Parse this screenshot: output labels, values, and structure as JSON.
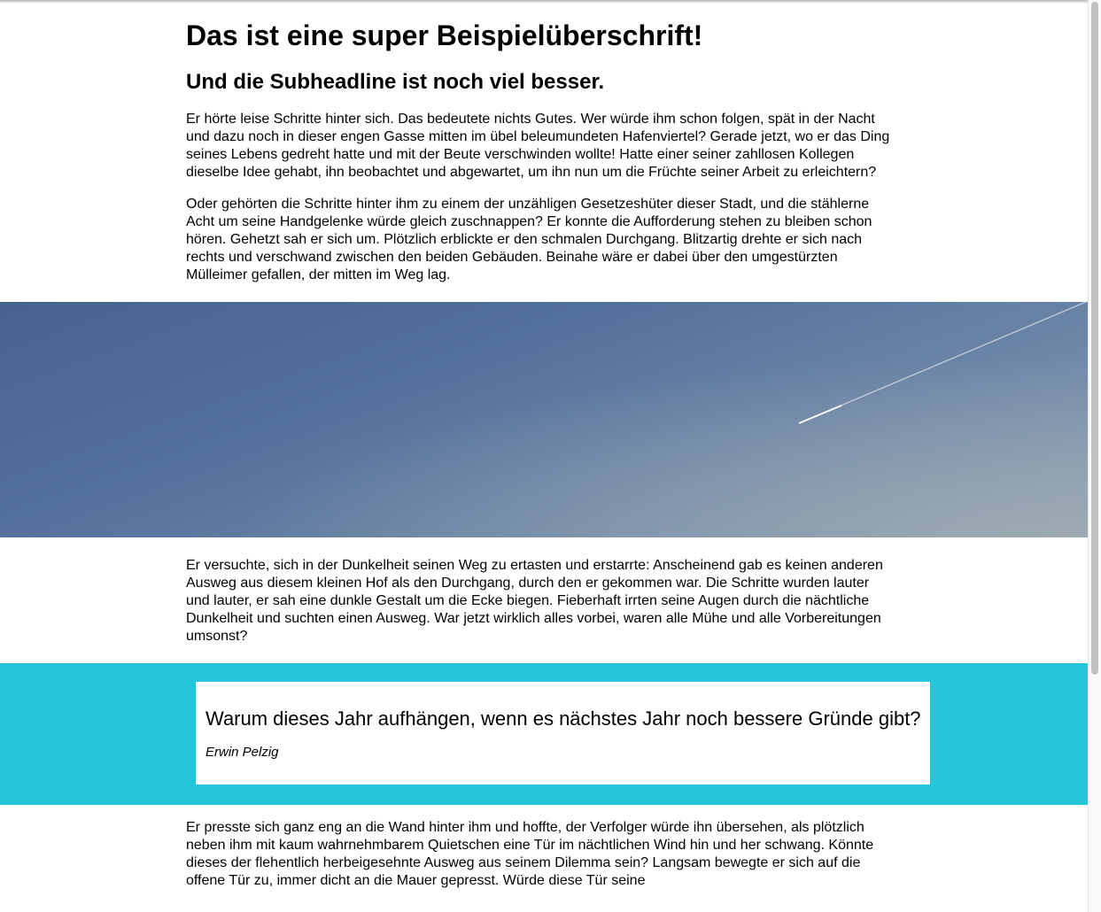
{
  "article": {
    "headline": "Das ist eine super Beispielüberschrift!",
    "subheadline": "Und die Subheadline ist noch viel besser.",
    "paragraph_1": "Er hörte leise Schritte hinter sich. Das bedeutete nichts Gutes. Wer würde ihm schon folgen, spät in der Nacht und dazu noch in dieser engen Gasse mitten im übel beleumundeten Hafenviertel? Gerade jetzt, wo er das Ding seines Lebens gedreht hatte und mit der Beute verschwinden wollte! Hatte einer seiner zahllosen Kollegen dieselbe Idee gehabt, ihn beobachtet und abgewartet, um ihn nun um die Früchte seiner Arbeit zu erleichtern?",
    "paragraph_2": "Oder gehörten die Schritte hinter ihm zu einem der unzähligen Gesetzeshüter dieser Stadt, und die stählerne Acht um seine Handgelenke würde gleich zuschnappen? Er konnte die Aufforderung stehen zu bleiben schon hören. Gehetzt sah er sich um. Plötzlich erblickte er den schmalen Durchgang. Blitzartig drehte er sich nach rechts und verschwand zwischen den beiden Gebäuden. Beinahe wäre er dabei über den umgestürzten Mülleimer gefallen, der mitten im Weg lag.",
    "paragraph_3": "Er versuchte, sich in der Dunkelheit seinen Weg zu ertasten und erstarrte: Anscheinend gab es keinen anderen Ausweg aus diesem kleinen Hof als den Durchgang, durch den er gekommen war. Die Schritte wurden lauter und lauter, er sah eine dunkle Gestalt um die Ecke biegen. Fieberhaft irrten seine Augen durch die nächtliche Dunkelheit und suchten einen Ausweg. War jetzt wirklich alles vorbei, waren alle Mühe und alle Vorbereitungen umsonst?",
    "paragraph_4": "Er presste sich ganz eng an die Wand hinter ihm und hoffte, der Verfolger würde ihn übersehen, als plötzlich neben ihm mit kaum wahrnehmbarem Quietschen eine Tür im nächtlichen Wind hin und her schwang. Könnte dieses der flehentlich herbeigesehnte Ausweg aus seinem Dilemma sein? Langsam bewegte er sich auf die offene Tür zu, immer dicht an die Mauer gepresst. Würde diese Tür seine"
  },
  "hero_image": {
    "subject": "blue sky with airplane contrail"
  },
  "quote": {
    "text": "Warum dieses Jahr aufhängen, wenn es nächstes Jahr noch bessere Gründe gibt?",
    "author": "Erwin Pelzig"
  },
  "colors": {
    "quote_band": "#26c6da",
    "text": "#000000",
    "background": "#ffffff"
  }
}
